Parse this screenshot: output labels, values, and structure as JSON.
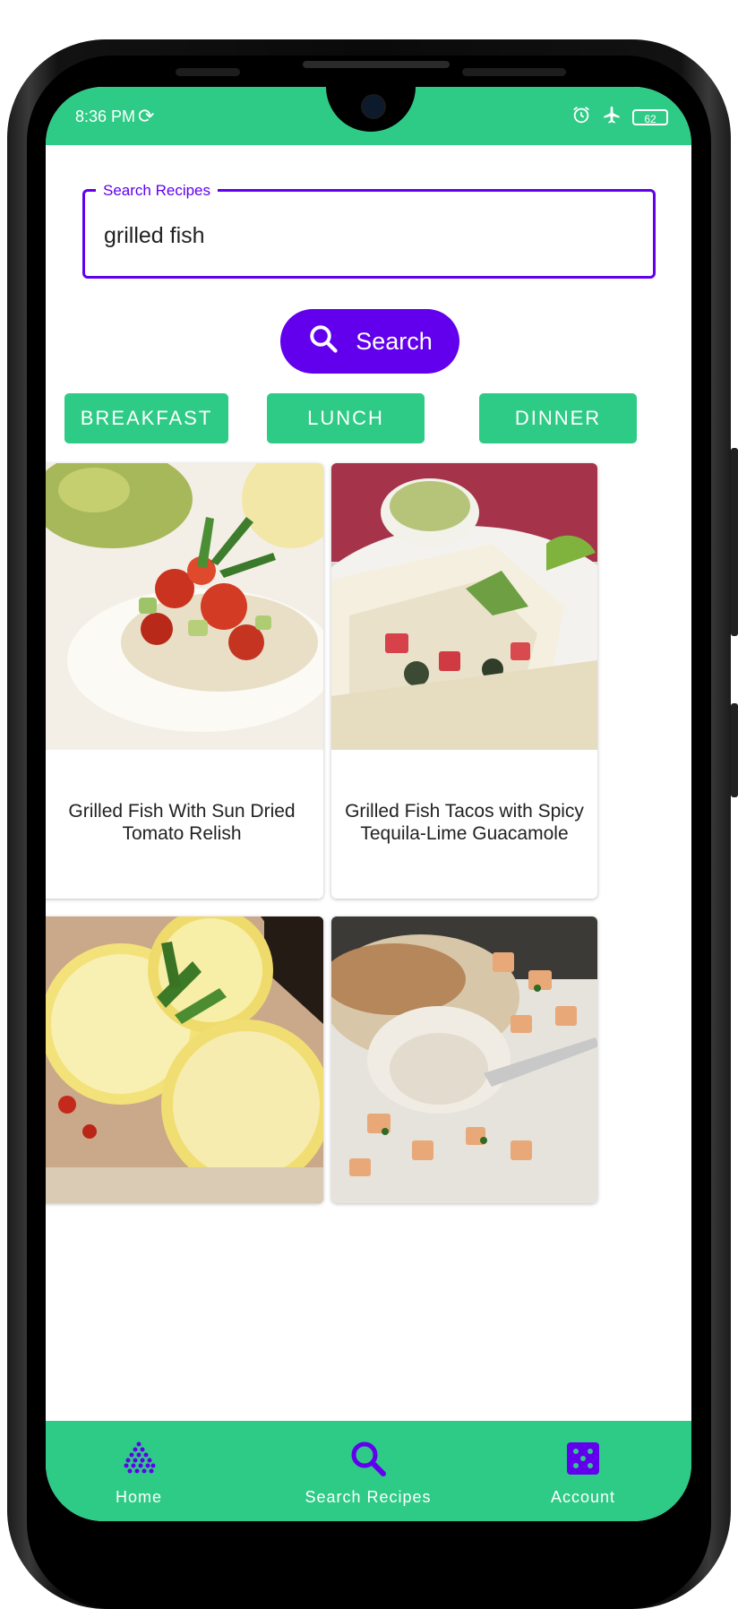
{
  "status_bar": {
    "time": "8:36 PM",
    "battery": "62"
  },
  "search": {
    "label": "Search Recipes",
    "value": "grilled fish"
  },
  "search_button": {
    "label": "Search"
  },
  "categories": [
    "BREAKFAST",
    "LUNCH",
    "DINNER"
  ],
  "recipes": [
    {
      "title": "Grilled Fish With Sun Dried Tomato Relish"
    },
    {
      "title": "Grilled Fish Tacos with Spicy Tequila-Lime Guacamole"
    }
  ],
  "nav": {
    "items": [
      {
        "label": "Home",
        "icon": "home-icon"
      },
      {
        "label": "Search Recipes",
        "icon": "search-icon"
      },
      {
        "label": "Account",
        "icon": "dice-icon"
      }
    ]
  },
  "colors": {
    "primary": "#6200ee",
    "accent": "#2ecb86"
  }
}
